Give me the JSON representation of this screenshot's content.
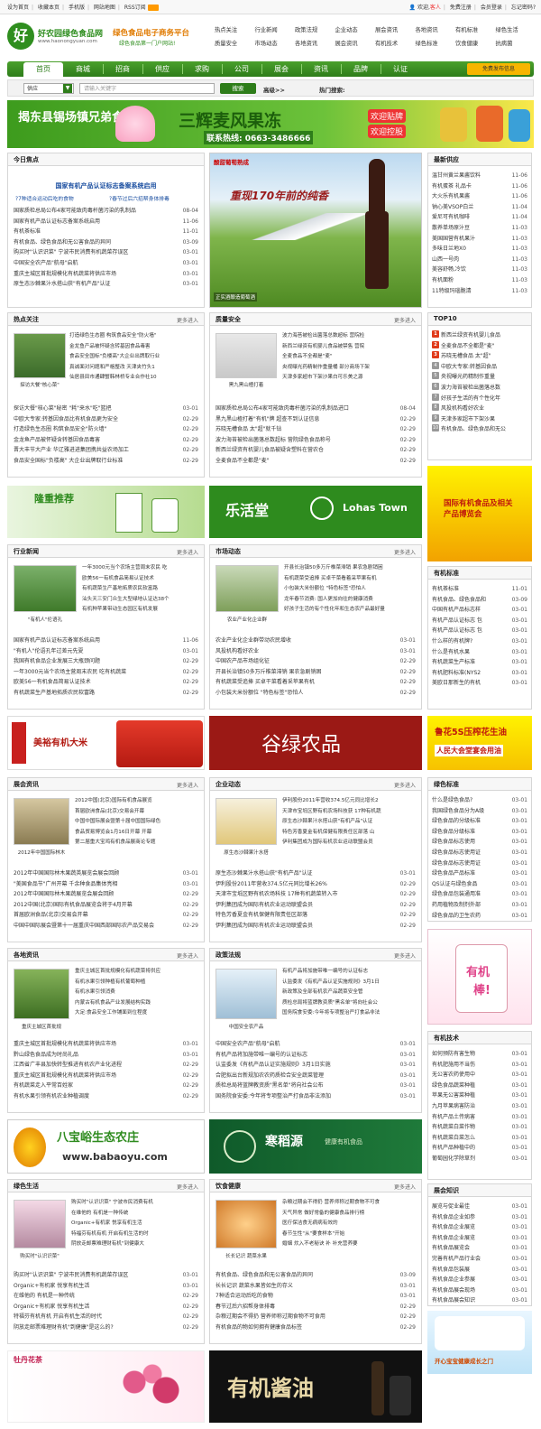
{
  "topbar": {
    "links": [
      "设为首页",
      "收藏本页",
      "手机版",
      "网站地图",
      "RSS订阅"
    ],
    "welcome": "欢迎,",
    "guest": "客人",
    "register": "免费注册",
    "login": "会员登录",
    "forgot": "忘记密码?"
  },
  "logo": {
    "mark": "好",
    "title": "好农园绿色食品网",
    "url": "www.haonongyuan.com",
    "slogan1": "绿色食品电子商务平台",
    "slogan2": "绿色食品第一门户网站!"
  },
  "categories": [
    "热点关注",
    "行业新闻",
    "政策法规",
    "企业动态",
    "展会资讯",
    "各地资讯",
    "有机标准",
    "绿色生活",
    "抗病机",
    "质量安全",
    "市场动态",
    "各地资讯",
    "展会资讯",
    "有机技术",
    "绿色标准",
    "饮食健康",
    "抗病菌"
  ],
  "nav": {
    "items": [
      "首页",
      "商城",
      "招商",
      "供应",
      "求购",
      "公司",
      "展会",
      "资讯",
      "品牌",
      "认证"
    ],
    "supply_btn": "免费发布信息"
  },
  "search": {
    "select": "供应",
    "placeholder": "请输入关键字",
    "button": "搜索",
    "advanced": "高级>>",
    "hot": "热门搜索:"
  },
  "banner": {
    "t1": "揭东县锡场镇兄弟食品厂",
    "t2": "三辉麦风果冻",
    "t3": "联系热线: 0663-3486666",
    "t4": "欢迎贴牌",
    "t5": "欢迎控股"
  },
  "today": {
    "title": "今日焦点",
    "headline": "国家有机产品认证标志备案系统启用",
    "sub1": "?7种适合运动后吃的食物",
    "sub2": "?春节过后六招帮身体排毒",
    "rows": [
      [
        "国家质检总局公布4家可能致肉毒杆菌污染的乳制品",
        "08-04"
      ],
      [
        "国家有机产品认证标志备案系统启用",
        "11-06"
      ],
      [
        "有机茶标准",
        "11-01"
      ],
      [
        "有机食品、绿色食品和无公害食品的异同",
        "03-09"
      ],
      [
        "购买时\"认识识菜\" 宁波市民消费有机蔬菜存误区",
        "03-01"
      ],
      [
        "中国安全农产品\"航母\"启航",
        "03-01"
      ],
      [
        "重庆主城区首批规模化有机蔬菜将供应市场",
        "03-01"
      ],
      [
        "原生态沙棘果汁水搭山获\"有机产品\"认证",
        "03-01"
      ]
    ]
  },
  "feature": {
    "line1": "酸甜葡萄熟成",
    "line2": "重现170年前的纯香",
    "caption": "正实酒酿造葡萄酒"
  },
  "newsupply": {
    "title": "最新供应",
    "rows": [
      [
        "温甘州黄兰果酱饮料",
        "11-06"
      ],
      [
        "有机蛋茶 礼品卡",
        "11-06"
      ],
      [
        "大火乐有机果酱",
        "11-06"
      ],
      [
        "钠心美VSOP白兰",
        "11-04"
      ],
      [
        "爱尼可有机咖啡",
        "11-04"
      ],
      [
        "散养单场原汁豆",
        "11-03"
      ],
      [
        "美国国营有机果汁",
        "11-03"
      ],
      [
        "多味日兰地X0",
        "11-03"
      ],
      [
        "山西一号肉",
        "11-03"
      ],
      [
        "美容舒畅,冷饮",
        "11-03"
      ],
      [
        "有机面粉",
        "11-03"
      ],
      [
        "11特级玛瑙脆清",
        "11-03"
      ]
    ]
  },
  "hot": {
    "title": "热点关注",
    "more": "更多进入",
    "thumb_caption": "探访大餐\"核心菜\"",
    "paras": [
      "打造绿色生态圈 构筑食品安全\"防火墙\"",
      "金龙鱼产品被怀疑含转基因食品毒害",
      "食品安全国标\"负楼高\"大企业出牌取行业",
      "真诚面对问题和严格整改 天津夹竹头1",
      "仙居县田市通肆蟹韩林桥专业合作社10"
    ],
    "rows": [
      [
        "探访大餐\"核心菜\"秘密 \"耗\"来水\"吃\"篮把",
        "03-01"
      ],
      [
        "中欧大专家:转基因食品比有机食品更为安全",
        "02-29"
      ],
      [
        "打造绿色生态圈 构筑食品安全\"防火墙\"",
        "02-29"
      ],
      [
        "金龙鱼产品被怀疑含转基因食品毒害",
        "02-29"
      ],
      [
        "晋大丰节大产业 华辽雅进进集团携共益农场加工",
        "02-29"
      ],
      [
        "食品安全国标\"负楼高\" 大企业出牌取行业标准",
        "02-29"
      ]
    ]
  },
  "quality": {
    "title": "质量安全",
    "more": "更多进入",
    "thumb_caption": "黑九黑山楂打着",
    "paras": [
      "波力海苔被检出菌落总数超标 营院检",
      "新西兰绿资有机婴儿食品被禁售 营院",
      "全麦食品不全都是\"麦\"",
      "央视曝光药精制作重量桶 部分商场下架",
      "天津多家超市下架沙果白可乐美之源",
      "",
      "",
      "",
      ""
    ],
    "rows": [
      [
        "国家质检总局公布4家可能致肉毒杆菌污染的乳制品进口",
        "08-04"
      ],
      [
        "黑九黑山楂打着\"有机\"牌 超查不到认证信息",
        "02-29"
      ],
      [
        "苏晓无槽食品 太\"超\"就千钻",
        "02-29"
      ],
      [
        "波力海苔被检出菌落总数超标 营院绿色食品称号",
        "02-29"
      ],
      [
        "新西兰绿资有机婴儿食品被疑含塑料在营农仓",
        "02-29"
      ],
      [
        "全麦食品不全都是\"麦\"",
        "02-29"
      ]
    ]
  },
  "top10": {
    "title": "TOP10",
    "rows": [
      "新西兰绿资有机婴儿食品",
      "全麦食品不全都是\"麦\"",
      "苏晓无槽食品 太\"超\"",
      "中欧大专家:转基因食品",
      "央视曝光药精制作重量",
      "波力海苔被检出菌落总数",
      "好孩子生活的有个性化年",
      "风投机构看好农业",
      "天津多家超市下架沙果",
      "有机食品、绿色食品和无公"
    ]
  },
  "ad1": {
    "left": "隆重推荐",
    "mid": "乐活堂",
    "mid_en": "Lohas Town",
    "right": "国际有机食品及相关产品博览会"
  },
  "industry": {
    "title": "行业新闻",
    "more": "更多进入",
    "thumb_caption": "\"有机人\"伦语孔",
    "paras": [
      "一年3000元当个农场主营周末农民 吃",
      "欧美56一有机食品简易认证技术",
      "有机蔬菜生产基地拓质农民软富路",
      "汕头天三安门众生大型绿地认证达38个",
      "有机种苹果带动生态园区有机发展"
    ],
    "rows": [
      [
        "国家有机产品认证标志备案系统启用",
        "11-06"
      ],
      [
        "\"有机人\"伦语孔年过差元先夏",
        "03-01"
      ],
      [
        "我国有机食品企业发展三大瓶颈问题",
        "02-29"
      ],
      [
        "一年3000元当个农场主营周末农民 吃有机蔬菜",
        "02-29"
      ],
      [
        "欧美56一有机食品简易认证技术",
        "02-29"
      ],
      [
        "有机蔬菜生产基地拓质农民软富路",
        "02-29"
      ]
    ]
  },
  "market": {
    "title": "市场动态",
    "more": "更多进入",
    "thumb_caption": "农业产业化企业群",
    "paras": [
      "开县长治镇50多万斤椎菜滞销 果农急剧销困",
      "有机蔬菜受追捧 买卓干菜看着采苹果有机",
      "小包装大米份额位 \"特色标签\"恐怕人",
      "龙年春节消费: 国人更加向往的健康消费",
      "好孩子生活的有个性化年和生态农产品最好量"
    ],
    "rows": [
      [
        "农业产业化企业群带动农民增收",
        "03-01"
      ],
      [
        "风投机构看好农业",
        "03-01"
      ],
      [
        "中国农产品市场组化征",
        "02-29"
      ],
      [
        "开县长治镇50多万斤椎菜滞销 果农急剧销困",
        "02-29"
      ],
      [
        "有机蔬菜受追捧 买卓干菜看着采苹果有机",
        "02-29"
      ],
      [
        "小包装大米份额位 \"特色标签\"恐怕人",
        "02-29"
      ]
    ]
  },
  "organicstd": {
    "title": "有机标准",
    "rows": [
      "有机茶标准",
      "有机食品、绿色食品和",
      "中国有机产品标志样",
      "有机产品认证标志 包",
      "有机产品认证标志 包",
      "什么样的有机牌?",
      "什么是有机水果",
      "有机蔬菜生产标准",
      "有机肥料标准(NYS2",
      "美欧日那新生的有机"
    ],
    "dates": [
      "11-01",
      "03-09",
      "03-01",
      "03-01",
      "03-01",
      "03-01",
      "03-01",
      "03-01",
      "03-01",
      "03-01"
    ]
  },
  "ad2": {
    "left": "美裕有机大米",
    "mid": "谷绿农品",
    "right1": "鲁花5S压榨花生油",
    "right2": "人民大会堂宴会用油"
  },
  "expo": {
    "title": "展会资讯",
    "more": "更多进入",
    "thumb_caption": "2012年中国国际林木",
    "paras": [
      "2012中国(北京)国际有机食品展览",
      "首届欧洲食品(北京)交易会开幕",
      "中国中国际展会暨第十届中国国际绿色",
      "食品贸易博览会1月16日开幕 开幕",
      "第二届重大宝鸡有机食品展商论专题"
    ],
    "rows": [
      [
        "2012年中国国际林木果蔬英展览会展会回顾",
        "03-01"
      ],
      [
        "\"美国食品节\"广州开幕 千余种食品集体亮相",
        "03-01"
      ],
      [
        "2012年中国国际林木果蔬展览会展会回顾",
        "02-29"
      ],
      [
        "2012中国(北京)国际有机食品展览会将于4月开幕",
        "02-29"
      ],
      [
        "首届欧洲食品(北京)交易会开幕",
        "02-29"
      ],
      [
        "中国中国际展会暨第十一届重庆中国西部国际农产品交易会",
        "02-29"
      ]
    ]
  },
  "company": {
    "title": "企业动态",
    "more": "更多进入",
    "thumb_caption": "原生态沙棘果汁水搭",
    "paras": [
      "伊利股份2011年营收374.5亿元同比增长2",
      "天津市宝坻区野有机农场科技获 17种有机蔬",
      "原生态沙棘果汁水搭山获\"有机产品\"认证",
      "特色芳香夏金有机保健有限责任区部落 山",
      "伊利集团成为国际有机农业运动联盟会员"
    ],
    "rows": [
      [
        "原生态沙棘果汁水搭山获\"有机产品\"认证",
        "03-01"
      ],
      [
        "伊利股份2011年营收374.5亿元同比增长26%",
        "02-29"
      ],
      [
        "天津市宝坻区野有机农场科技 17种有机蔬菜转入市",
        "02-29"
      ],
      [
        "伊利集团成为国际有机农业运动联盟会员",
        "02-29"
      ],
      [
        "特色芳香夏金有机保健有限责任区部落",
        "02-29"
      ],
      [
        "伊利集团成为国际有机农业运动联盟会员",
        "02-29"
      ]
    ]
  },
  "greenstd": {
    "title": "绿色标准",
    "rows": [
      "什么是绿色食品?",
      "我国绿色食品分为A级",
      "绿色食品的分级标准",
      "绿色食品分级标准",
      "绿色食品标志使用",
      "绿色食品标志使用证",
      "绿色食品标志使用证",
      "绿色食品产品标准",
      "QS认证与绿色食品",
      "绿色食品包装通用准",
      "药用植物及制剂外部",
      "绿色食品的卫生农药"
    ],
    "dates": [
      "03-01",
      "03-01",
      "03-01",
      "03-01",
      "03-01",
      "03-01",
      "03-01",
      "03-01",
      "03-01",
      "03-01",
      "03-01",
      "03-01"
    ]
  },
  "regional": {
    "title": "各地资讯",
    "more": "更多进入",
    "thumb_caption": "重庆主城区首批规",
    "paras": [
      "重庆主城区首批规模化有机蔬菜将供应",
      "有机水果引领种植有机葡萄种植",
      "有机水果引领消费",
      "内蒙古有机食品产业发展结构实践",
      "大足:食品安全工作铺面到位程度"
    ],
    "rows": [
      [
        "重庆主城区首批规模化有机蔬菜将供应市场",
        "03-01"
      ],
      [
        "黔山绿色食品成为时尚礼品",
        "03-01"
      ],
      [
        "江西省广丰县加快转型推进有机农产业化进程",
        "02-29"
      ],
      [
        "重庆主城区首批规模化有机蔬菜将供应市场",
        "02-29"
      ],
      [
        "有机蔬菜走入平常百姓家",
        "02-29"
      ],
      [
        "有机水果引领有机农业种植调度",
        "02-29"
      ]
    ]
  },
  "policy": {
    "title": "政策法规",
    "more": "更多进入",
    "thumb_caption": "中国安全农产品",
    "paras": [
      "有机产品将加施带唯一编号的认证标志",
      "认监委发《有机产品认证实施规则》3月1日",
      "新政策及全部有机农产品蔬菜安全管",
      "质检总局将蓝牌教资质\"黑名单\"将向社会公",
      "国务院食安委:今年将专项整治严打食品非法"
    ],
    "rows": [
      [
        "中国安全农产品\"航母\"启航",
        "03-01"
      ],
      [
        "有机产品将加施带唯一编号的认证标志",
        "03-01"
      ],
      [
        "认监委发《有机产品认证实施规则》3月1日实施",
        "03-01"
      ],
      [
        "合肥拟出台新规加农农药质检合安全蔬菜管理",
        "03-01"
      ],
      [
        "质检总局将蓝牌教资质\"黑名单\"将向社会公布",
        "03-01"
      ],
      [
        "国务院食安委:今年将专项整治严打食品非法添加",
        "03-01"
      ]
    ]
  },
  "ad_cert": {
    "line1": "有机",
    "line2": "棒!"
  },
  "organictech": {
    "title": "有机技术",
    "rows": [
      "如何预防有害生物",
      "有机肥施用不当伤",
      "无公害农药使用中",
      "绿色食品蔬菜种植",
      "苹果无公害菜种植",
      "九月苹果病害防治",
      "有机产品土传病害",
      "有机蔬菜白菜作物",
      "有机蔬菜白菜怎么",
      "有机产品种植中的",
      "葡萄园化学除草剂"
    ],
    "dates": [
      "03-01",
      "03-01",
      "03-01",
      "03-01",
      "03-01",
      "03-01",
      "03-01",
      "03-01",
      "03-01",
      "03-01",
      "03-01"
    ]
  },
  "ad3": {
    "left": "八宝峪生态农庄",
    "left_url": "www.babaoyu.com",
    "right": "寒稻源",
    "right_sub": "健康有机食品"
  },
  "greenlife": {
    "title": "绿色生活",
    "more": "更多进入",
    "thumb_caption": "购买时\"认识识菜\"",
    "paras": [
      "购买时\"认识识菜\" 宁波市民消费有机",
      "在维他的 有机是一种传统",
      "Organic+有机家 悦享有机生活",
      "特福芬有机有机 开启有机生活的时",
      "阴放走邮票难理财有机\"到健康大"
    ],
    "rows": [
      [
        "购买时\"认识识菜\" 宁波市民消费有机蔬菜存误区",
        "03-01"
      ],
      [
        "Organic+有机家 悦享有机生活",
        "03-01"
      ],
      [
        "在维他的 有机是一种传统",
        "02-29"
      ],
      [
        "Organic+有机家 悦享有机生活",
        "02-29"
      ],
      [
        "特福芬有机有机 开启有机生活的时代",
        "02-29"
      ],
      [
        "阴放走邮票难理财有机\"到健康\"是这么的?",
        "02-29"
      ]
    ]
  },
  "diet": {
    "title": "饮食健康",
    "more": "更多进入",
    "thumb_caption": "长长记识 蔬菜水果",
    "paras": [
      "杂粮过期会不得扔 营养师称过期食物不可食",
      "天气异常 做好常备的健康食品排行榜",
      "医疗保洁食无病病有效的",
      "春节生性\"从\"要食样本\"开始",
      "婚姻 炊入不老秘诀 补 补充营养要"
    ],
    "rows": [
      [
        "有机食品、绿色食品和无公害食品的异同",
        "03-09"
      ],
      [
        "长长记识 蔬菜水果皆如生的存义",
        "03-01"
      ],
      [
        "7种适合运动后吃的食物",
        "03-01"
      ],
      [
        "春节过后六招帮身体排毒",
        "02-29"
      ],
      [
        "杂粮过期会不得扔 营养师称过期食物不可食用",
        "02-29"
      ],
      [
        "有机食品的物如何拥有健康食品标签",
        "02-29"
      ]
    ]
  },
  "expoknow": {
    "title": "展会知识",
    "rows": [
      "展览与促业最佳",
      "有机食品企业如参",
      "有机食品企业展览",
      "有机食品企业展览",
      "有机食品展览会",
      "完善有机产品行业会",
      "有机食品包装展",
      "有机食品企业参展",
      "有机食品展会现场",
      "有机食品展会知识"
    ],
    "dates": [
      "03-01",
      "03-01",
      "03-01",
      "03-01",
      "03-01",
      "03-01",
      "03-01",
      "03-01",
      "03-01",
      "03-01"
    ]
  },
  "ad_kids": {
    "line1": "开心宝宝健康成长之门"
  },
  "ad4": {
    "left": "牡丹花茶",
    "right": "有机酱油"
  }
}
